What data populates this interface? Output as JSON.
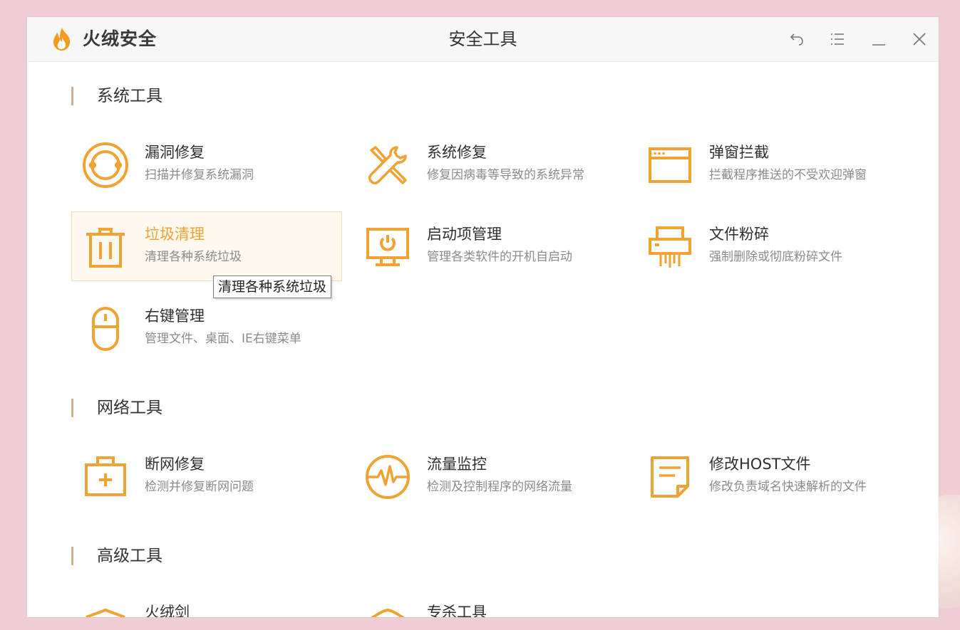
{
  "app": {
    "name": "火绒安全",
    "window_title": "安全工具"
  },
  "colors": {
    "accent": "#f0a233",
    "section_bar": "#c7b18f"
  },
  "titlebar_controls": [
    {
      "name": "back-icon"
    },
    {
      "name": "menu-icon"
    },
    {
      "name": "minimize-icon"
    },
    {
      "name": "close-icon"
    }
  ],
  "sections": {
    "system": {
      "title": "系统工具",
      "tools": [
        {
          "name": "漏洞修复",
          "desc": "扫描并修复系统漏洞",
          "icon": "vulnerability-repair-icon"
        },
        {
          "name": "系统修复",
          "desc": "修复因病毒等导致的系统异常",
          "icon": "wrench-screwdriver-icon"
        },
        {
          "name": "弹窗拦截",
          "desc": "拦截程序推送的不受欢迎弹窗",
          "icon": "popup-window-icon"
        },
        {
          "name": "垃圾清理",
          "desc": "清理各种系统垃圾",
          "icon": "trash-can-icon",
          "active": true
        },
        {
          "name": "启动项管理",
          "desc": "管理各类软件的开机自启动",
          "icon": "monitor-power-icon"
        },
        {
          "name": "文件粉碎",
          "desc": "强制删除或彻底粉碎文件",
          "icon": "shredder-icon"
        },
        {
          "name": "右键管理",
          "desc": "管理文件、桌面、IE右键菜单",
          "icon": "mouse-icon"
        }
      ]
    },
    "network": {
      "title": "网络工具",
      "tools": [
        {
          "name": "断网修复",
          "desc": "检测并修复断网问题",
          "icon": "first-aid-kit-icon"
        },
        {
          "name": "流量监控",
          "desc": "检测及控制程序的网络流量",
          "icon": "pulse-monitor-icon"
        },
        {
          "name": "修改HOST文件",
          "desc": "修改负责域名快速解析的文件",
          "icon": "host-file-icon"
        }
      ]
    },
    "advanced": {
      "title": "高级工具",
      "tools": [
        {
          "name": "火绒剑",
          "icon": "shield-icon"
        },
        {
          "name": "专杀工具",
          "icon": "shield-icon"
        }
      ]
    }
  },
  "tooltip": {
    "text": "清理各种系统垃圾"
  }
}
